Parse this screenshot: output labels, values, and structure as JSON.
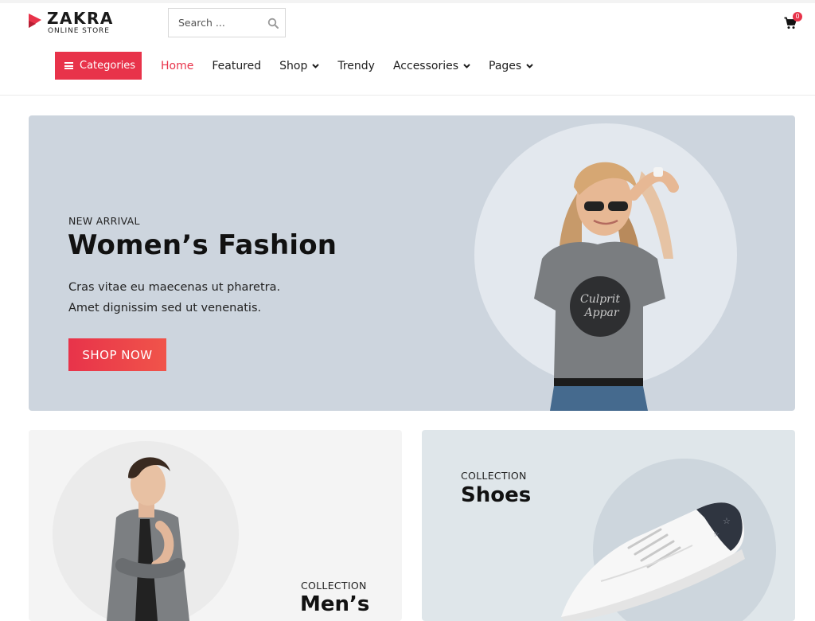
{
  "brand": {
    "name": "ZAKRA",
    "tagline": "ONLINE STORE",
    "accent_color": "#e8334a"
  },
  "search": {
    "placeholder": "Search ...",
    "icon": "search-icon"
  },
  "cart": {
    "icon": "cart-icon",
    "count": "0"
  },
  "categories_button": {
    "label": "Categories",
    "icon": "hamburger-icon"
  },
  "nav": {
    "items": [
      {
        "label": "Home",
        "active": true,
        "dropdown": false
      },
      {
        "label": "Featured",
        "active": false,
        "dropdown": false
      },
      {
        "label": "Shop",
        "active": false,
        "dropdown": true
      },
      {
        "label": "Trendy",
        "active": false,
        "dropdown": false
      },
      {
        "label": "Accessories",
        "active": false,
        "dropdown": true
      },
      {
        "label": "Pages",
        "active": false,
        "dropdown": true
      }
    ]
  },
  "hero": {
    "kicker": "NEW ARRIVAL",
    "title": "Women’s Fashion",
    "description_lines": [
      "Cras vitae eu maecenas ut pharetra.",
      "Amet dignissim sed ut venenatis."
    ],
    "button_label": "SHOP NOW",
    "background_color": "#cdd5de",
    "image": "woman-in-gray-tshirt-image",
    "tshirt_print": [
      "Culprit",
      "Appar"
    ]
  },
  "collections": [
    {
      "kicker": "COLLECTION",
      "title": "Men’s",
      "image": "man-in-gray-blazer-image"
    },
    {
      "kicker": "COLLECTION",
      "title": "Shoes",
      "image": "white-sneaker-image"
    }
  ]
}
